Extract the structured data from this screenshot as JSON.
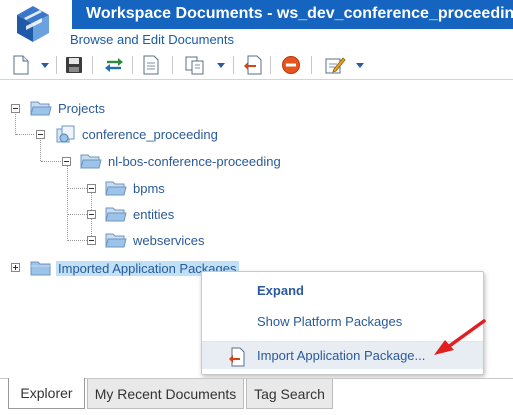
{
  "window": {
    "title": "Workspace Documents - ws_dev_conference_proceeding",
    "subtitle": "Browse and Edit Documents"
  },
  "toolbar": {
    "icons": [
      "new-document-icon",
      "dropdown-icon",
      "save-icon",
      "sync-icon",
      "properties-icon",
      "copy-icon",
      "dropdown-icon",
      "import-icon",
      "remove-icon",
      "edit-icon",
      "dropdown-icon"
    ]
  },
  "tree": {
    "root": {
      "label": "Projects"
    },
    "project": {
      "label": "conference_proceeding"
    },
    "package": {
      "label": "nl-bos-conference-proceeding"
    },
    "children": [
      {
        "label": "bpms"
      },
      {
        "label": "entities"
      },
      {
        "label": "webservices"
      }
    ],
    "imported": {
      "label": "Imported Application Packages"
    }
  },
  "context_menu": {
    "items": [
      {
        "label": "Expand"
      },
      {
        "label": "Show Platform Packages"
      },
      {
        "label": "Import Application Package..."
      }
    ]
  },
  "tabs": [
    {
      "label": "Explorer",
      "active": true
    },
    {
      "label": "My Recent Documents",
      "active": false
    },
    {
      "label": "Tag Search",
      "active": false
    }
  ],
  "colors": {
    "title_bar": "#1565c0",
    "link_text": "#2a5a99",
    "selection": "#bfe0f5",
    "arrow": "#e02020"
  }
}
